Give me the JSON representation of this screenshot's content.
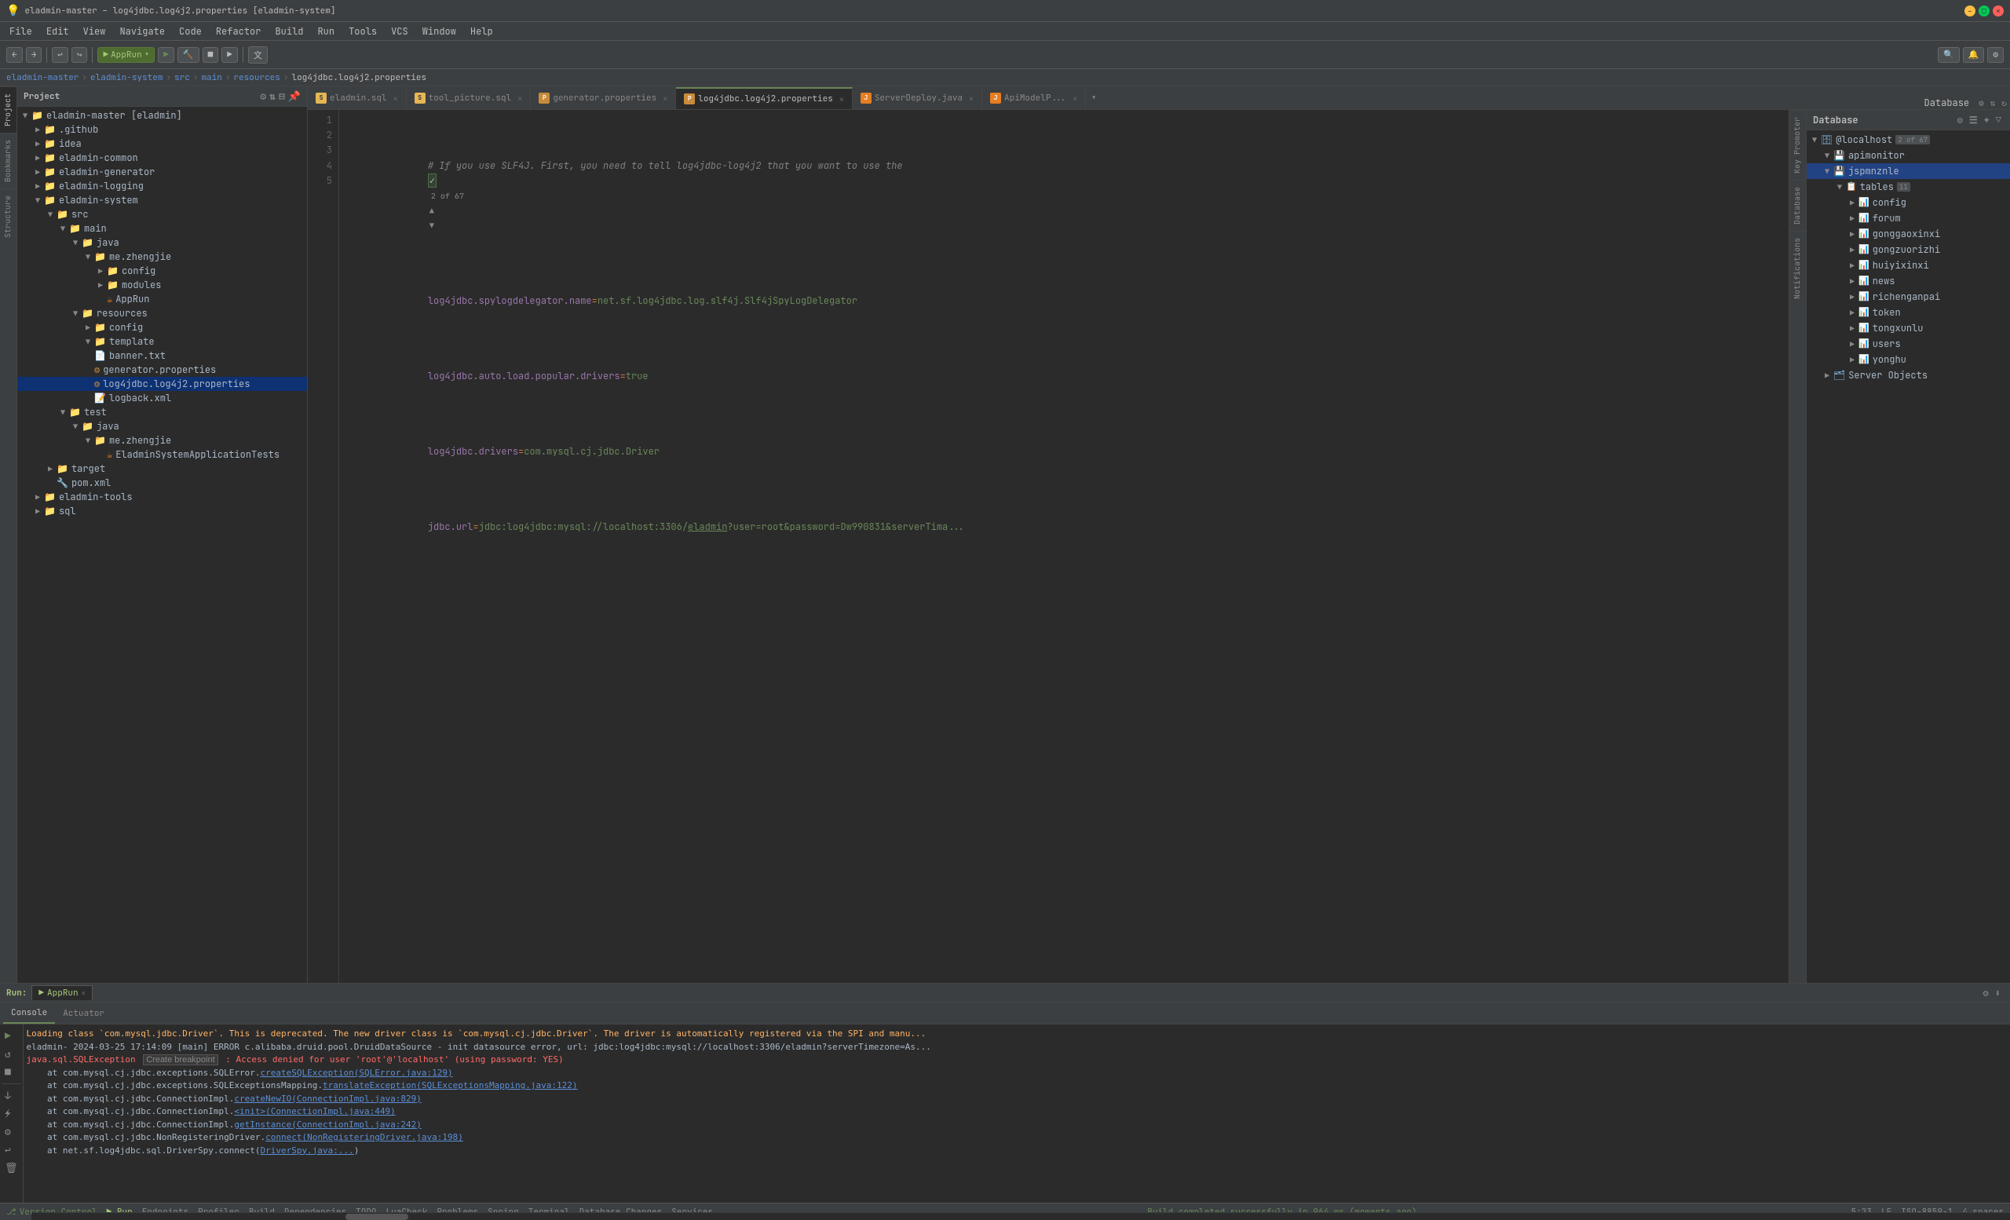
{
  "window": {
    "title": "eladmin-master – log4jdbc.log4j2.properties [eladmin-system]",
    "min": "–",
    "max": "□",
    "close": "✕"
  },
  "menu": {
    "items": [
      "File",
      "Edit",
      "View",
      "Navigate",
      "Code",
      "Refactor",
      "Build",
      "Run",
      "Tools",
      "VCS",
      "Window",
      "Help"
    ]
  },
  "toolbar": {
    "back": "←",
    "forward": "→",
    "apprun_label": "AppRun",
    "run": "▶",
    "build_icon": "🔨",
    "stop": "■",
    "run2": "▶",
    "search_everywhere": "🔍",
    "settings": "⚙"
  },
  "breadcrumb": {
    "items": [
      "eladmin-master",
      "eladmin-system",
      "src",
      "main",
      "resources",
      "log4jdbc.log4j2.properties"
    ]
  },
  "project_panel": {
    "title": "Project",
    "root": "eladmin-master [eladmin]",
    "tree": [
      {
        "indent": 0,
        "arrow": "▼",
        "icon": "📁",
        "name": "eladmin-master [eladmin]",
        "type": "folder"
      },
      {
        "indent": 1,
        "arrow": "▶",
        "icon": "📁",
        "name": ".github",
        "type": "folder"
      },
      {
        "indent": 1,
        "arrow": "▶",
        "icon": "📁",
        "name": "idea",
        "type": "folder"
      },
      {
        "indent": 1,
        "arrow": "▶",
        "icon": "📁",
        "name": "eladmin-common",
        "type": "folder"
      },
      {
        "indent": 1,
        "arrow": "▶",
        "icon": "📁",
        "name": "eladmin-generator",
        "type": "folder"
      },
      {
        "indent": 1,
        "arrow": "▶",
        "icon": "📁",
        "name": "eladmin-logging",
        "type": "folder"
      },
      {
        "indent": 1,
        "arrow": "▼",
        "icon": "📁",
        "name": "eladmin-system",
        "type": "folder"
      },
      {
        "indent": 2,
        "arrow": "▼",
        "icon": "📁",
        "name": "src",
        "type": "folder"
      },
      {
        "indent": 3,
        "arrow": "▼",
        "icon": "📁",
        "name": "main",
        "type": "folder"
      },
      {
        "indent": 4,
        "arrow": "▼",
        "icon": "📁",
        "name": "java",
        "type": "folder"
      },
      {
        "indent": 5,
        "arrow": "▼",
        "icon": "📁",
        "name": "me.zhengjie",
        "type": "folder"
      },
      {
        "indent": 6,
        "arrow": "▶",
        "icon": "📁",
        "name": "config",
        "type": "folder"
      },
      {
        "indent": 6,
        "arrow": "▶",
        "icon": "📁",
        "name": "modules",
        "type": "folder"
      },
      {
        "indent": 6,
        "arrow": "",
        "icon": "☕",
        "name": "AppRun",
        "type": "java"
      },
      {
        "indent": 4,
        "arrow": "▼",
        "icon": "📁",
        "name": "resources",
        "type": "folder"
      },
      {
        "indent": 5,
        "arrow": "▶",
        "icon": "📁",
        "name": "config",
        "type": "folder"
      },
      {
        "indent": 5,
        "arrow": "▼",
        "icon": "📁",
        "name": "template",
        "type": "folder",
        "selected": false
      },
      {
        "indent": 5,
        "arrow": "",
        "icon": "📄",
        "name": "banner.txt",
        "type": "txt"
      },
      {
        "indent": 5,
        "arrow": "",
        "icon": "⚙",
        "name": "generator.properties",
        "type": "props"
      },
      {
        "indent": 5,
        "arrow": "",
        "icon": "⚙",
        "name": "log4jdbc.log4j2.properties",
        "type": "props",
        "active": true
      },
      {
        "indent": 5,
        "arrow": "",
        "icon": "📝",
        "name": "logback.xml",
        "type": "xml"
      },
      {
        "indent": 3,
        "arrow": "▼",
        "icon": "📁",
        "name": "test",
        "type": "folder"
      },
      {
        "indent": 4,
        "arrow": "▼",
        "icon": "📁",
        "name": "java",
        "type": "folder"
      },
      {
        "indent": 5,
        "arrow": "▼",
        "icon": "📁",
        "name": "me.zhengjie",
        "type": "folder"
      },
      {
        "indent": 6,
        "arrow": "",
        "icon": "☕",
        "name": "EladminSystemApplicationTests",
        "type": "java"
      },
      {
        "indent": 2,
        "arrow": "▶",
        "icon": "📁",
        "name": "target",
        "type": "folder"
      },
      {
        "indent": 2,
        "arrow": "",
        "icon": "🔧",
        "name": "pom.xml",
        "type": "xml"
      },
      {
        "indent": 1,
        "arrow": "▶",
        "icon": "📁",
        "name": "eladmin-tools",
        "type": "folder"
      },
      {
        "indent": 1,
        "arrow": "▶",
        "icon": "📁",
        "name": "sql",
        "type": "folder"
      }
    ]
  },
  "tabs": [
    {
      "label": "eladmin.sql",
      "icon_type": "sql",
      "active": false,
      "closable": true
    },
    {
      "label": "tool_picture.sql",
      "icon_type": "sql",
      "active": false,
      "closable": true
    },
    {
      "label": "generator.properties",
      "icon_type": "props",
      "active": false,
      "closable": true
    },
    {
      "label": "log4jdbc.log4j2.properties",
      "icon_type": "props",
      "active": true,
      "closable": true
    },
    {
      "label": "ServerDeploy.java",
      "icon_type": "java",
      "active": false,
      "closable": true
    },
    {
      "label": "ApiModelP...",
      "icon_type": "java",
      "active": false,
      "closable": true
    }
  ],
  "editor": {
    "search_count": "2 of 67",
    "lines": [
      {
        "num": 1,
        "parts": [
          {
            "cls": "kw-comment",
            "text": "# If you use SLF4J. First, you need to tell log4jdbc-log4j2 that you want to use the "
          }
        ]
      },
      {
        "num": 2,
        "parts": [
          {
            "cls": "kw-key",
            "text": "log4jdbc.spylogdelegator.name"
          },
          {
            "cls": "kw-equal",
            "text": "="
          },
          {
            "cls": "kw-value",
            "text": "net.sf.log4jdbc.log.slf4j.Slf4jSpyLogDelegator"
          }
        ]
      },
      {
        "num": 3,
        "parts": [
          {
            "cls": "kw-key",
            "text": "log4jdbc.auto.load.popular.drivers"
          },
          {
            "cls": "kw-equal",
            "text": "="
          },
          {
            "cls": "kw-value",
            "text": "true"
          }
        ]
      },
      {
        "num": 4,
        "parts": [
          {
            "cls": "kw-key",
            "text": "log4jdbc.drivers"
          },
          {
            "cls": "kw-equal",
            "text": "="
          },
          {
            "cls": "kw-value",
            "text": "com.mysql.cj.jdbc.Driver"
          }
        ]
      },
      {
        "num": 5,
        "parts": [
          {
            "cls": "kw-key",
            "text": "jdbc.url"
          },
          {
            "cls": "kw-equal",
            "text": "="
          },
          {
            "cls": "kw-value",
            "text": "jdbc:log4jdbc:mysql://localhost:3306/eladmin?user=root&password=Dw990831&serverTima..."
          }
        ]
      }
    ]
  },
  "database_panel": {
    "title": "Database",
    "connection": "@localhost",
    "counter": "2 of 67",
    "items": [
      {
        "indent": 0,
        "arrow": "▼",
        "name": "@localhost",
        "type": "connection",
        "badge": "2 of 67"
      },
      {
        "indent": 1,
        "arrow": "▼",
        "name": "apimonitor",
        "type": "db"
      },
      {
        "indent": 1,
        "arrow": "▼",
        "name": "jspmnznle",
        "type": "db",
        "selected": true
      },
      {
        "indent": 2,
        "arrow": "▼",
        "name": "tables",
        "type": "folder",
        "badge": "11"
      },
      {
        "indent": 3,
        "arrow": "▶",
        "name": "config",
        "type": "table"
      },
      {
        "indent": 3,
        "arrow": "▶",
        "name": "forum",
        "type": "table"
      },
      {
        "indent": 3,
        "arrow": "▶",
        "name": "gonggaoxinxi",
        "type": "table"
      },
      {
        "indent": 3,
        "arrow": "▶",
        "name": "gongzuorizhi",
        "type": "table"
      },
      {
        "indent": 3,
        "arrow": "▶",
        "name": "huiyixinxi",
        "type": "table"
      },
      {
        "indent": 3,
        "arrow": "▶",
        "name": "news",
        "type": "table"
      },
      {
        "indent": 3,
        "arrow": "▶",
        "name": "richenganpai",
        "type": "table"
      },
      {
        "indent": 3,
        "arrow": "▶",
        "name": "token",
        "type": "table"
      },
      {
        "indent": 3,
        "arrow": "▶",
        "name": "tongxunlu",
        "type": "table"
      },
      {
        "indent": 3,
        "arrow": "▶",
        "name": "users",
        "type": "table"
      },
      {
        "indent": 3,
        "arrow": "▶",
        "name": "yonghu",
        "type": "table"
      },
      {
        "indent": 1,
        "arrow": "▶",
        "name": "Server Objects",
        "type": "folder"
      }
    ]
  },
  "run_panel": {
    "label": "Run:",
    "tab_label": "AppRun",
    "logs": [
      {
        "cls": "log-warn",
        "text": "Loading class `com.mysql.jdbc.Driver`. This is deprecated. The new driver class is `com.mysql.cj.jdbc.Driver`. The driver is automatically registered via the SPI and manu..."
      },
      {
        "cls": "log-info",
        "text": "eladmin- 2024-03-25 17:14:09 [main] ERROR c.alibaba.druid.pool.DruidDataSource - init datasource error, url: jdbc:log4jdbc:mysql://localhost:3306/eladmin?serverTimezone=As..."
      },
      {
        "cls": "log-error",
        "text": "java.sql.SQLException Create breakpoint : Access denied for user 'root'@'localhost' (using password: YES)"
      },
      {
        "cls": "log-info",
        "text": "\tat com.mysql.cj.jdbc.exceptions.SQLError.createSQLException(SQLError.java:129)"
      },
      {
        "cls": "log-info",
        "text": "\tat com.mysql.cj.jdbc.exceptions.SQLExceptionsMapping.translateException(SQLExceptionsMapping.java:122)"
      },
      {
        "cls": "log-info",
        "text": "\tat com.mysql.cj.jdbc.ConnectionImpl.createNewIO(ConnectionImpl.java:829)"
      },
      {
        "cls": "log-info",
        "text": "\tat com.mysql.cj.jdbc.ConnectionImpl.<init>(ConnectionImpl.java:449)"
      },
      {
        "cls": "log-info",
        "text": "\tat com.mysql.cj.jdbc.ConnectionImpl.getInstance(ConnectionImpl.java:242)"
      },
      {
        "cls": "log-info",
        "text": "\tat com.mysql.cj.jdbc.NonRegisteringDriver.connect(NonRegisteringDriver.java:198)"
      },
      {
        "cls": "log-info",
        "text": "\tat net.sf.log4jdbc.sql.DriverSpy.connect(DriverSpy.java:..."
      }
    ]
  },
  "bottom_tabs": {
    "run_label": "Run:",
    "console_label": "Console",
    "actuator_label": "Actuator"
  },
  "status_bar": {
    "vcs": "Version Control",
    "run": "Run",
    "endpoints": "Endpoints",
    "profiler": "Profiler",
    "build": "Build",
    "dependencies": "Dependencies",
    "todo": "TODO",
    "lua_check": "LuaCheck",
    "problems": "Problems",
    "spring": "Spring",
    "terminal": "Terminal",
    "db_changes": "Database Changes",
    "services": "Services",
    "position": "5:23",
    "line_sep": "LF",
    "encoding": "ISO-8859-1",
    "indent": "4 spaces",
    "build_status": "Build completed successfully in 964 ms (moments ago)"
  }
}
